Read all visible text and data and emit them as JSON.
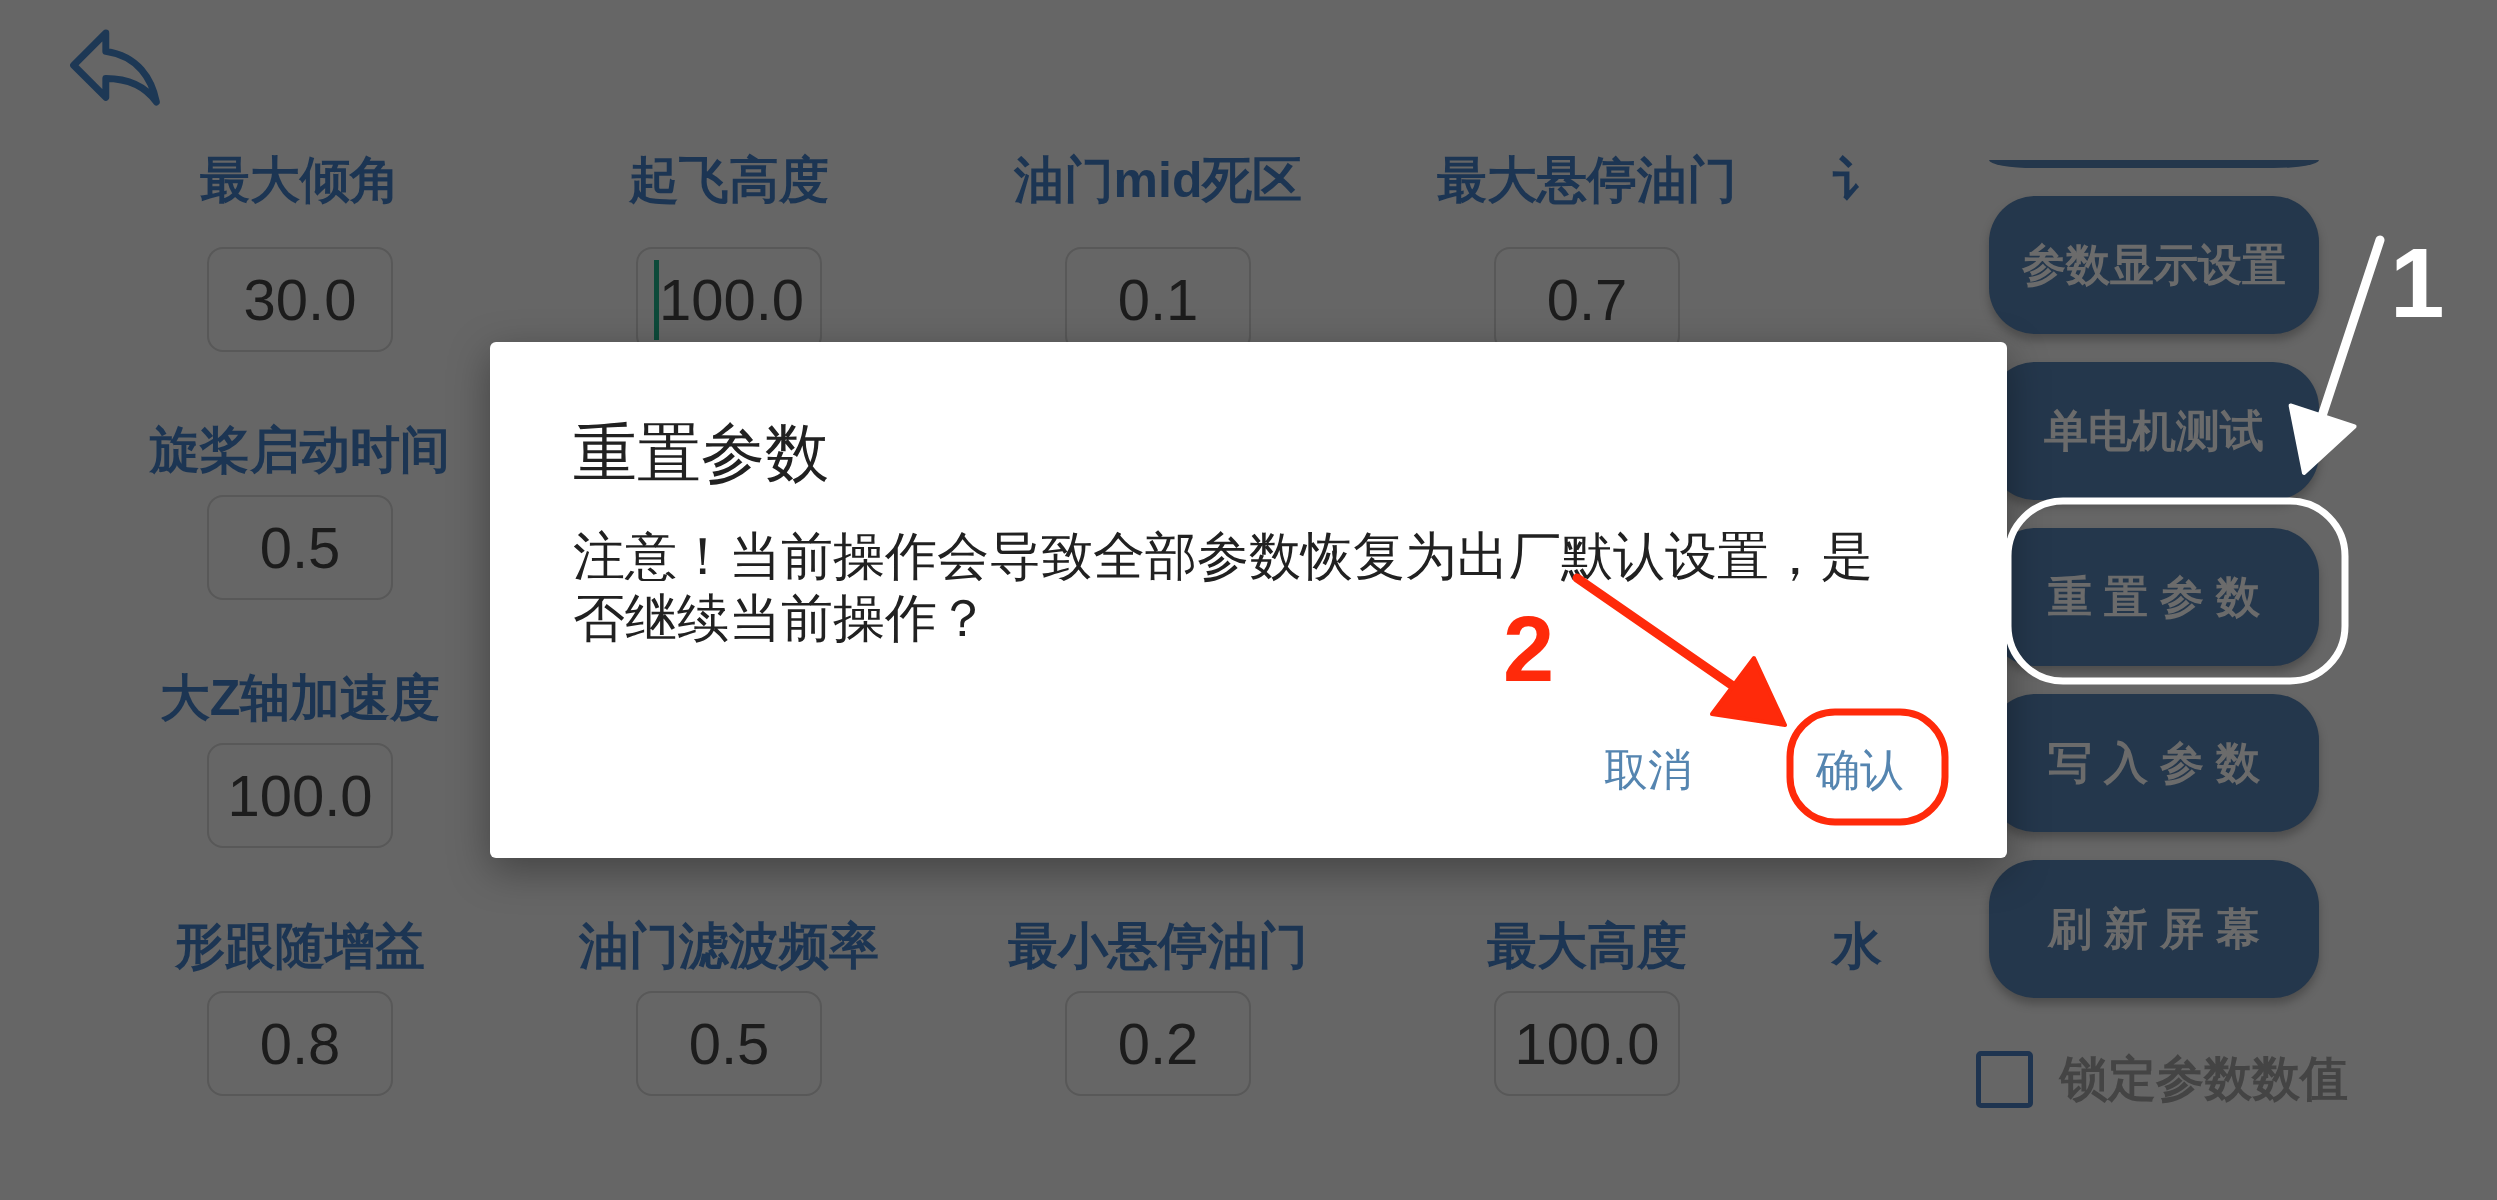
{
  "rows": [
    {
      "fields": [
        {
          "label": "最大倾角",
          "value": "30.0",
          "focused": false
        },
        {
          "label": "起飞高度",
          "value": "100.0",
          "focused": true
        },
        {
          "label": "油门mid死区",
          "value": "0.1",
          "focused": false
        },
        {
          "label": "最大悬停油门",
          "value": "0.7",
          "focused": false
        },
        {
          "label": "讠"
        }
      ]
    },
    {
      "fields": [
        {
          "label": "旋桨启动时间",
          "value": "0.5",
          "focused": false
        }
      ]
    },
    {
      "fields": [
        {
          "label": "大Z轴加速度",
          "value": "100.0",
          "focused": false
        }
      ]
    },
    {
      "fields": [
        {
          "label": "形跟随增益",
          "value": "0.8",
          "focused": false
        },
        {
          "label": "油门滤波频率",
          "value": "0.5",
          "focused": false
        },
        {
          "label": "最小悬停油门",
          "value": "0.2",
          "focused": false
        },
        {
          "label": "最大高度",
          "value": "100.0",
          "focused": false
        },
        {
          "label": "水"
        }
      ]
    }
  ],
  "side_buttons": [
    "参数显示设置",
    "单电机测试",
    "重 置 参 数",
    "写 入 参 数",
    "刷 新 屏 幕"
  ],
  "lock_checkbox": {
    "label": "锁定参数数值",
    "checked": false
  },
  "dialog": {
    "title": "重置参数",
    "message": "注意！当前操作会导致全部参数恢复为出厂默认设置，是否继续当前操作？",
    "buttons": [
      "取消",
      "确认"
    ]
  },
  "annotations": [
    {
      "label": "1",
      "color": "#ffffff"
    },
    {
      "label": "2",
      "color": "#ff2a0a"
    }
  ]
}
